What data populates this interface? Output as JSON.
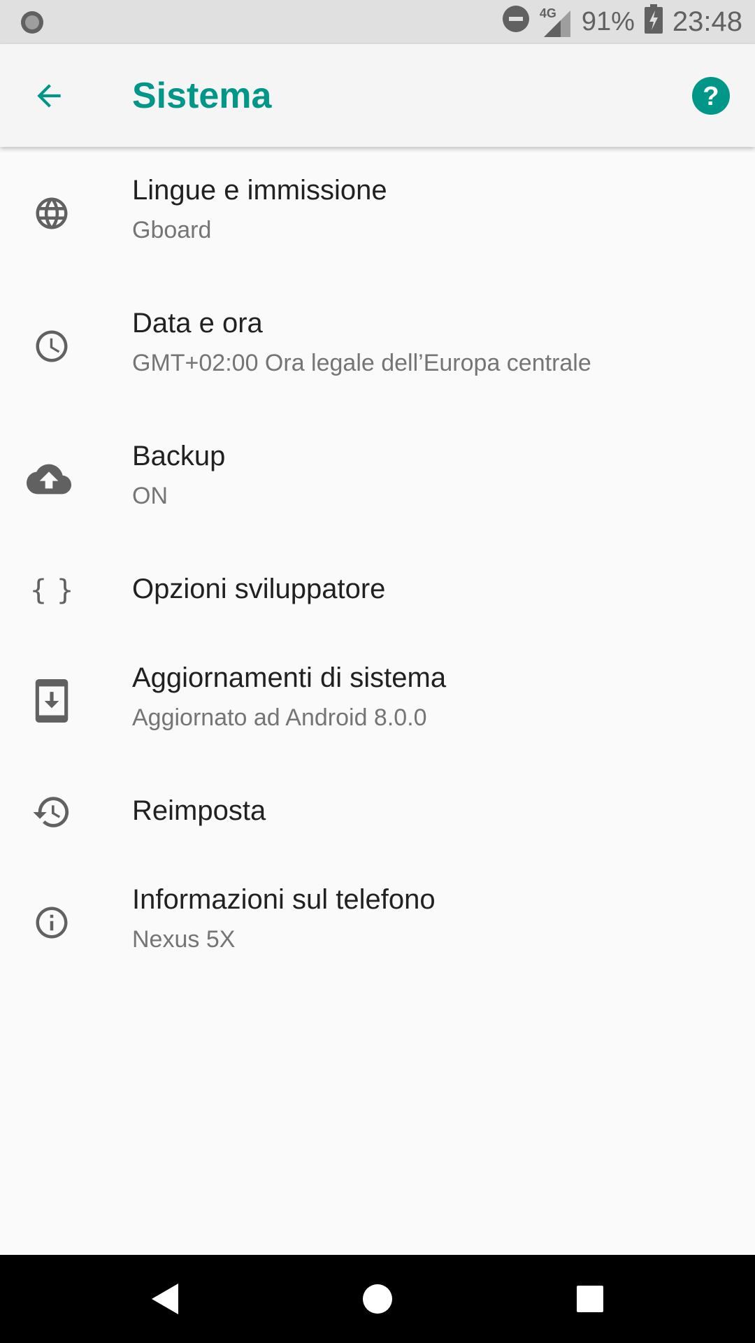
{
  "status_bar": {
    "network": "4G",
    "battery_percent": "91%",
    "time": "23:48",
    "icons": [
      "notification-dot-icon",
      "do-not-disturb-icon",
      "signal-icon",
      "battery-charging-icon"
    ]
  },
  "app_bar": {
    "title": "Sistema",
    "back_icon": "arrow-back-icon",
    "help_icon": "help-icon",
    "accent_color": "#009688"
  },
  "settings": [
    {
      "icon": "globe-icon",
      "title": "Lingue e immissione",
      "subtitle": "Gboard"
    },
    {
      "icon": "clock-icon",
      "title": "Data e ora",
      "subtitle": "GMT+02:00 Ora legale dell’Europa centrale"
    },
    {
      "icon": "cloud-upload-icon",
      "title": "Backup",
      "subtitle": "ON"
    },
    {
      "icon": "braces-icon",
      "title": "Opzioni sviluppatore",
      "subtitle": ""
    },
    {
      "icon": "system-update-icon",
      "title": "Aggiornamenti di sistema",
      "subtitle": "Aggiornato ad Android 8.0.0"
    },
    {
      "icon": "history-icon",
      "title": "Reimposta",
      "subtitle": ""
    },
    {
      "icon": "info-icon",
      "title": "Informazioni sul telefono",
      "subtitle": "Nexus 5X"
    }
  ],
  "nav_bar": {
    "icons": [
      "back-triangle-icon",
      "home-circle-icon",
      "recents-square-icon"
    ]
  }
}
